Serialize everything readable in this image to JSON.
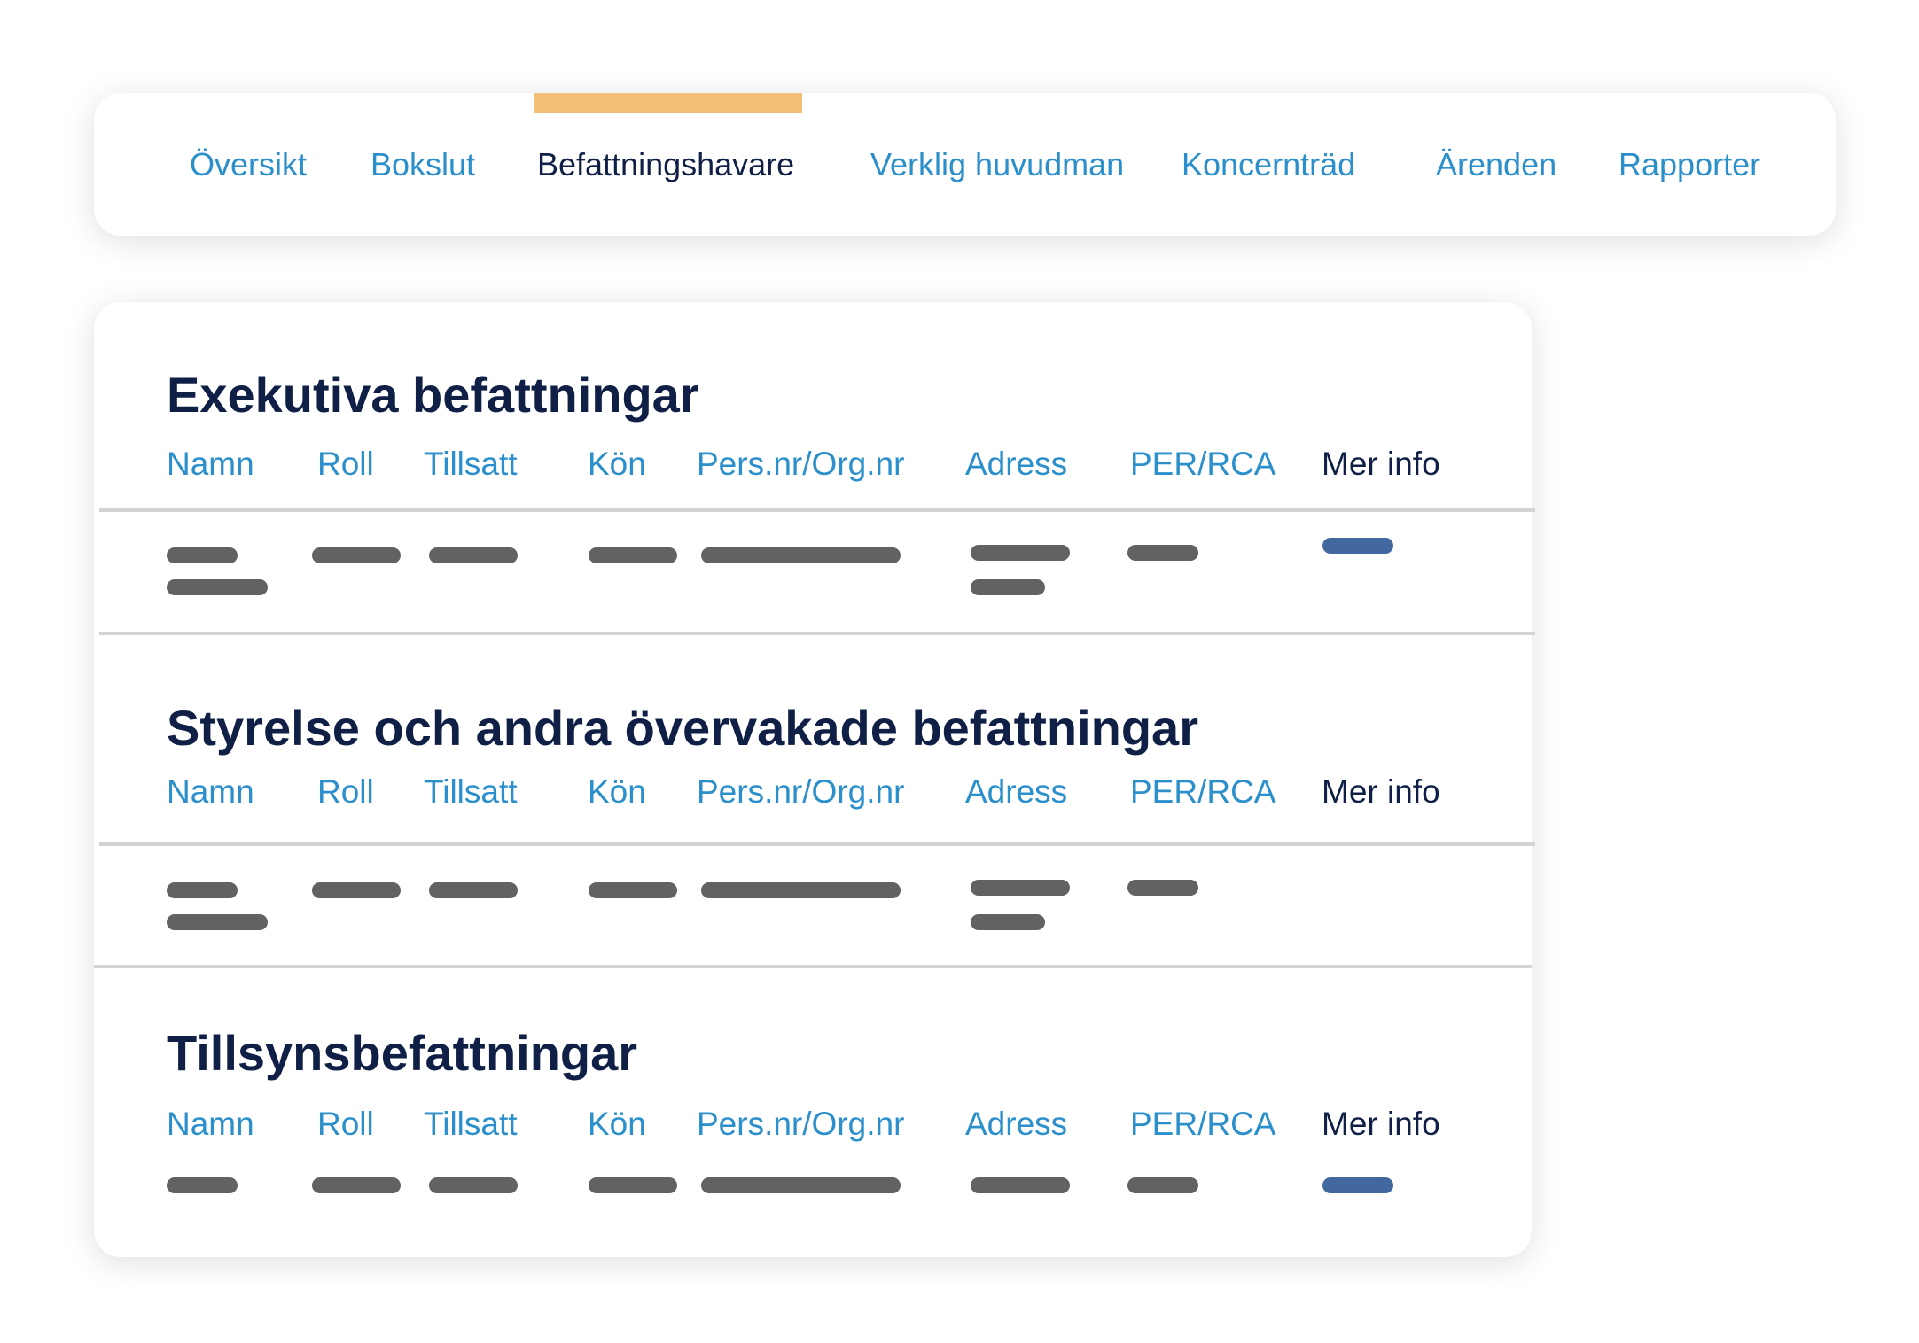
{
  "nav": {
    "tabs": [
      "Översikt",
      "Bokslut",
      "Befattningshavare",
      "Verklig huvudman",
      "Koncernträd",
      "Ärenden",
      "Rapporter"
    ],
    "active_tab": "Befattningshavare"
  },
  "columns": [
    "Namn",
    "Roll",
    "Tillsatt",
    "Kön",
    "Pers.nr/Org.nr",
    "Adress",
    "PER/RCA",
    "Mer info"
  ],
  "sections": [
    {
      "title": "Exekutiva befattningar"
    },
    {
      "title": "Styrelse och andra övervakade befattningar"
    },
    {
      "title": "Tillsynsbefattningar"
    }
  ],
  "colors": {
    "accent_tab": "#f2be78",
    "link_blue": "#2b8fcb",
    "heading_navy": "#0f1f45",
    "placeholder_gray": "#626262",
    "more_info_blue": "#43689f"
  }
}
